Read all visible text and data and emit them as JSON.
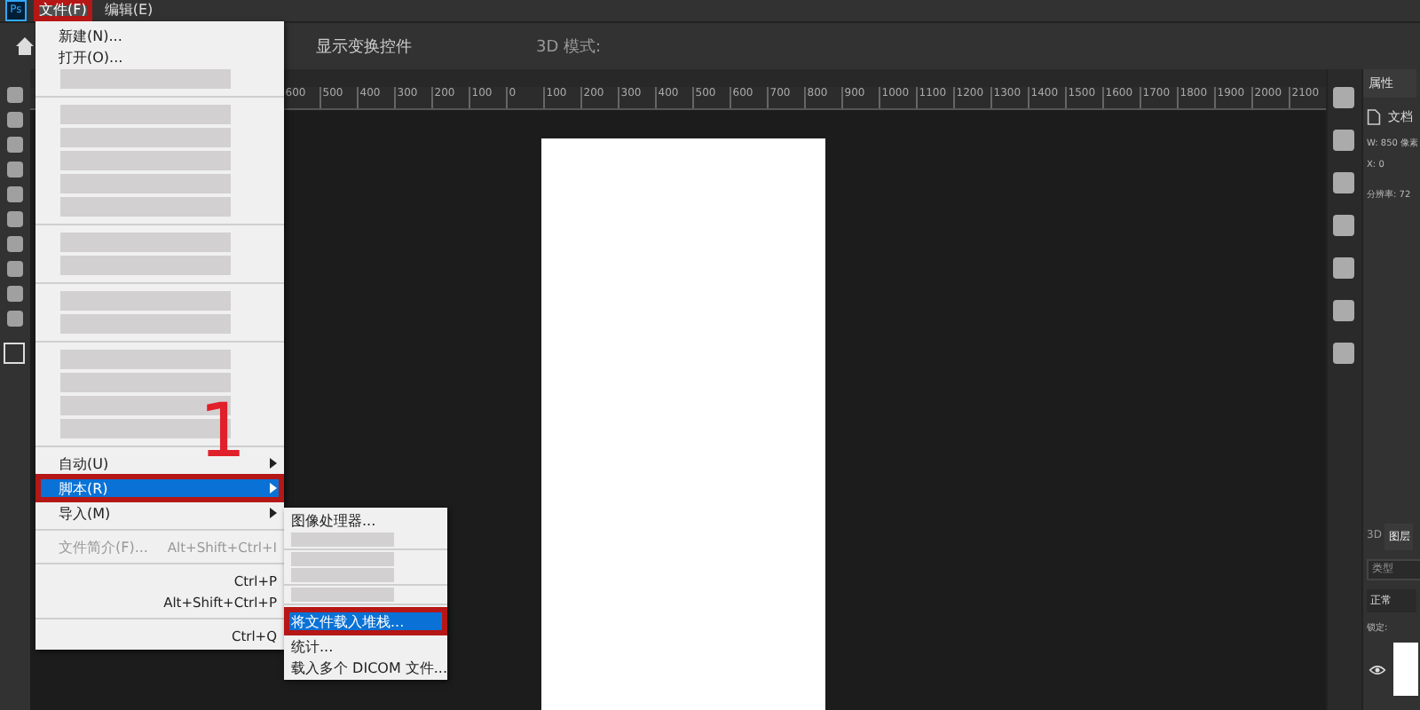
{
  "app_logo": "Ps",
  "menu_bar": [
    {
      "label": "文件(F)",
      "selected": true,
      "framed": true
    },
    {
      "label": "编辑(E)",
      "selected": false,
      "framed": false
    }
  ],
  "options_bar": {
    "label": "显示变换控件",
    "mode_label": "3D 模式:"
  },
  "ruler": [
    "600",
    "500",
    "400",
    "300",
    "200",
    "100",
    "0",
    "100",
    "200",
    "300",
    "400",
    "500",
    "600",
    "700",
    "800",
    "900",
    "1000",
    "1100",
    "1200",
    "1300",
    "1400",
    "1500",
    "1600",
    "1700",
    "1800",
    "1900",
    "2000",
    "2100"
  ],
  "file_menu": [
    {
      "kind": "item",
      "label": "新建(N)...",
      "selected": false,
      "disabled": false,
      "submenu": false,
      "framed": false
    },
    {
      "kind": "item",
      "label": "打开(O)...",
      "selected": false,
      "disabled": false,
      "submenu": false,
      "framed": false
    },
    {
      "kind": "blurred"
    },
    {
      "kind": "separator"
    },
    {
      "kind": "blurred"
    },
    {
      "kind": "blurred"
    },
    {
      "kind": "blurred"
    },
    {
      "kind": "blurred"
    },
    {
      "kind": "blurred"
    },
    {
      "kind": "separator"
    },
    {
      "kind": "blurred"
    },
    {
      "kind": "blurred"
    },
    {
      "kind": "separator"
    },
    {
      "kind": "blurred"
    },
    {
      "kind": "blurred"
    },
    {
      "kind": "separator"
    },
    {
      "kind": "blurred"
    },
    {
      "kind": "blurred"
    },
    {
      "kind": "blurred"
    },
    {
      "kind": "blurred"
    },
    {
      "kind": "separator"
    },
    {
      "kind": "item",
      "label": "自动(U)",
      "selected": false,
      "disabled": false,
      "submenu": true,
      "framed": false
    },
    {
      "kind": "item",
      "label": "脚本(R)",
      "selected": true,
      "disabled": false,
      "submenu": true,
      "framed": true
    },
    {
      "kind": "item",
      "label": "导入(M)",
      "selected": false,
      "disabled": false,
      "submenu": true,
      "framed": false
    },
    {
      "kind": "separator"
    },
    {
      "kind": "item",
      "label": "文件简介(F)...",
      "shortcut": "Alt+Shift+Ctrl+I",
      "selected": false,
      "disabled": true,
      "submenu": false,
      "framed": false
    },
    {
      "kind": "separator"
    },
    {
      "kind": "item",
      "shortcut": "Ctrl+P",
      "selected": false,
      "disabled": false,
      "submenu": false,
      "framed": false
    },
    {
      "kind": "item",
      "shortcut": "Alt+Shift+Ctrl+P",
      "selected": false,
      "disabled": false,
      "submenu": false,
      "framed": false
    },
    {
      "kind": "separator"
    },
    {
      "kind": "item",
      "shortcut": "Ctrl+Q",
      "selected": false,
      "disabled": false,
      "submenu": false,
      "framed": false
    }
  ],
  "scripts_submenu": [
    {
      "kind": "item",
      "label": "图像处理器...",
      "selected": false,
      "framed": false
    },
    {
      "kind": "blurred"
    },
    {
      "kind": "separator"
    },
    {
      "kind": "blurred"
    },
    {
      "kind": "blurred"
    },
    {
      "kind": "separator"
    },
    {
      "kind": "blurred"
    },
    {
      "kind": "separator"
    },
    {
      "kind": "item",
      "label": "将文件载入堆栈...",
      "selected": true,
      "framed": true
    },
    {
      "kind": "item",
      "label": "统计...",
      "selected": false,
      "framed": false
    },
    {
      "kind": "item",
      "label": "载入多个 DICOM 文件...",
      "selected": false,
      "framed": false
    }
  ],
  "annotation": "1",
  "properties_panel": {
    "tab": "属性",
    "doc_label": "文档",
    "width": "W:  850 像素",
    "x": "X:  0",
    "resolution": "分辨率: 72"
  },
  "layers_panel": {
    "tabs": [
      {
        "label": "3D",
        "selected": false
      },
      {
        "label": "图层",
        "selected": true
      }
    ],
    "search_placeholder": "类型",
    "blend_mode": "正常",
    "lock_label": "锁定:"
  }
}
